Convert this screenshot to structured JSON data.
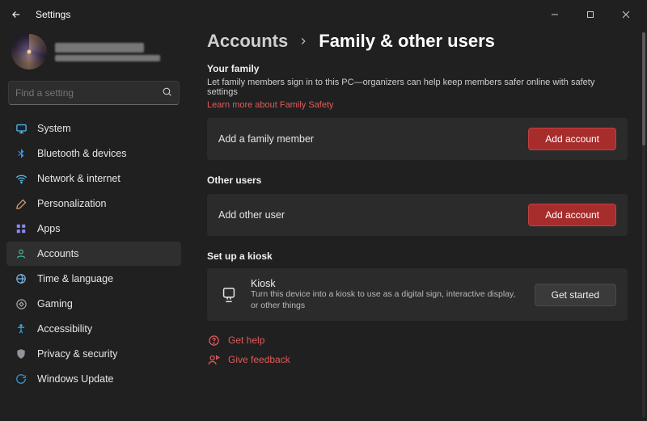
{
  "titlebar": {
    "title": "Settings"
  },
  "search": {
    "placeholder": "Find a setting"
  },
  "nav": {
    "items": [
      {
        "id": "system",
        "label": "System"
      },
      {
        "id": "bluetooth",
        "label": "Bluetooth & devices"
      },
      {
        "id": "network",
        "label": "Network & internet"
      },
      {
        "id": "personalization",
        "label": "Personalization"
      },
      {
        "id": "apps",
        "label": "Apps"
      },
      {
        "id": "accounts",
        "label": "Accounts"
      },
      {
        "id": "time",
        "label": "Time & language"
      },
      {
        "id": "gaming",
        "label": "Gaming"
      },
      {
        "id": "accessibility",
        "label": "Accessibility"
      },
      {
        "id": "privacy",
        "label": "Privacy & security"
      },
      {
        "id": "update",
        "label": "Windows Update"
      }
    ],
    "active": "accounts"
  },
  "breadcrumb": {
    "root": "Accounts",
    "current": "Family & other users"
  },
  "family": {
    "heading": "Your family",
    "description": "Let family members sign in to this PC—organizers can help keep members safer online with safety settings",
    "link": "Learn more about Family Safety",
    "add_label": "Add a family member",
    "add_button": "Add account"
  },
  "other": {
    "heading": "Other users",
    "add_label": "Add other user",
    "add_button": "Add account"
  },
  "kiosk": {
    "heading": "Set up a kiosk",
    "title": "Kiosk",
    "description": "Turn this device into a kiosk to use as a digital sign, interactive display, or other things",
    "button": "Get started"
  },
  "footer": {
    "help": "Get help",
    "feedback": "Give feedback"
  },
  "colors": {
    "accent_red": "#a72c2c",
    "link_red": "#e05a5a"
  }
}
